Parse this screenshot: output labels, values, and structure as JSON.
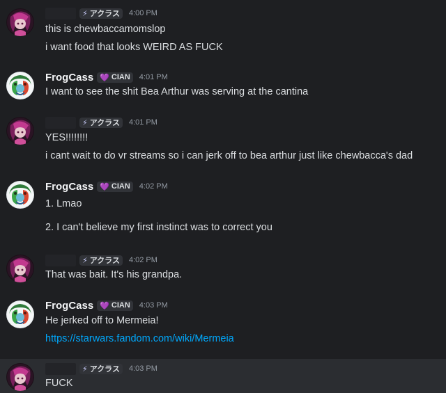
{
  "messages": [
    {
      "author": "",
      "tag": {
        "icon": "lightning-icon",
        "label": "アクラス"
      },
      "time": "4:00 PM",
      "lines": [
        "this is chewbaccamomslop",
        "i want food that looks WEIRD AS FUCK"
      ]
    },
    {
      "author": "FrogCass",
      "tag": {
        "icon": "heart-icon",
        "label": "CIAN"
      },
      "time": "4:01 PM",
      "lines": [
        "I want to see the shit Bea Arthur was serving at the cantina"
      ]
    },
    {
      "author": "",
      "tag": {
        "icon": "lightning-icon",
        "label": "アクラス"
      },
      "time": "4:01 PM",
      "lines": [
        "YES!!!!!!!!",
        "i cant wait to do vr streams so i can jerk off to bea arthur just like chewbacca's dad"
      ]
    },
    {
      "author": "FrogCass",
      "tag": {
        "icon": "heart-icon",
        "label": "CIAN"
      },
      "time": "4:02 PM",
      "lines": [
        "1. Lmao",
        "2. I can't believe my first instinct was to correct you"
      ]
    },
    {
      "author": "",
      "tag": {
        "icon": "lightning-icon",
        "label": "アクラス"
      },
      "time": "4:02 PM",
      "lines": [
        "That was bait. It's his grandpa."
      ]
    },
    {
      "author": "FrogCass",
      "tag": {
        "icon": "heart-icon",
        "label": "CIAN"
      },
      "time": "4:03 PM",
      "lines": [
        "He jerked off to Mermeia!"
      ],
      "link": "https://starwars.fandom.com/wiki/Mermeia"
    },
    {
      "author": "",
      "tag": {
        "icon": "lightning-icon",
        "label": "アクラス"
      },
      "time": "4:03 PM",
      "lines": [
        "FUCK"
      ]
    }
  ]
}
